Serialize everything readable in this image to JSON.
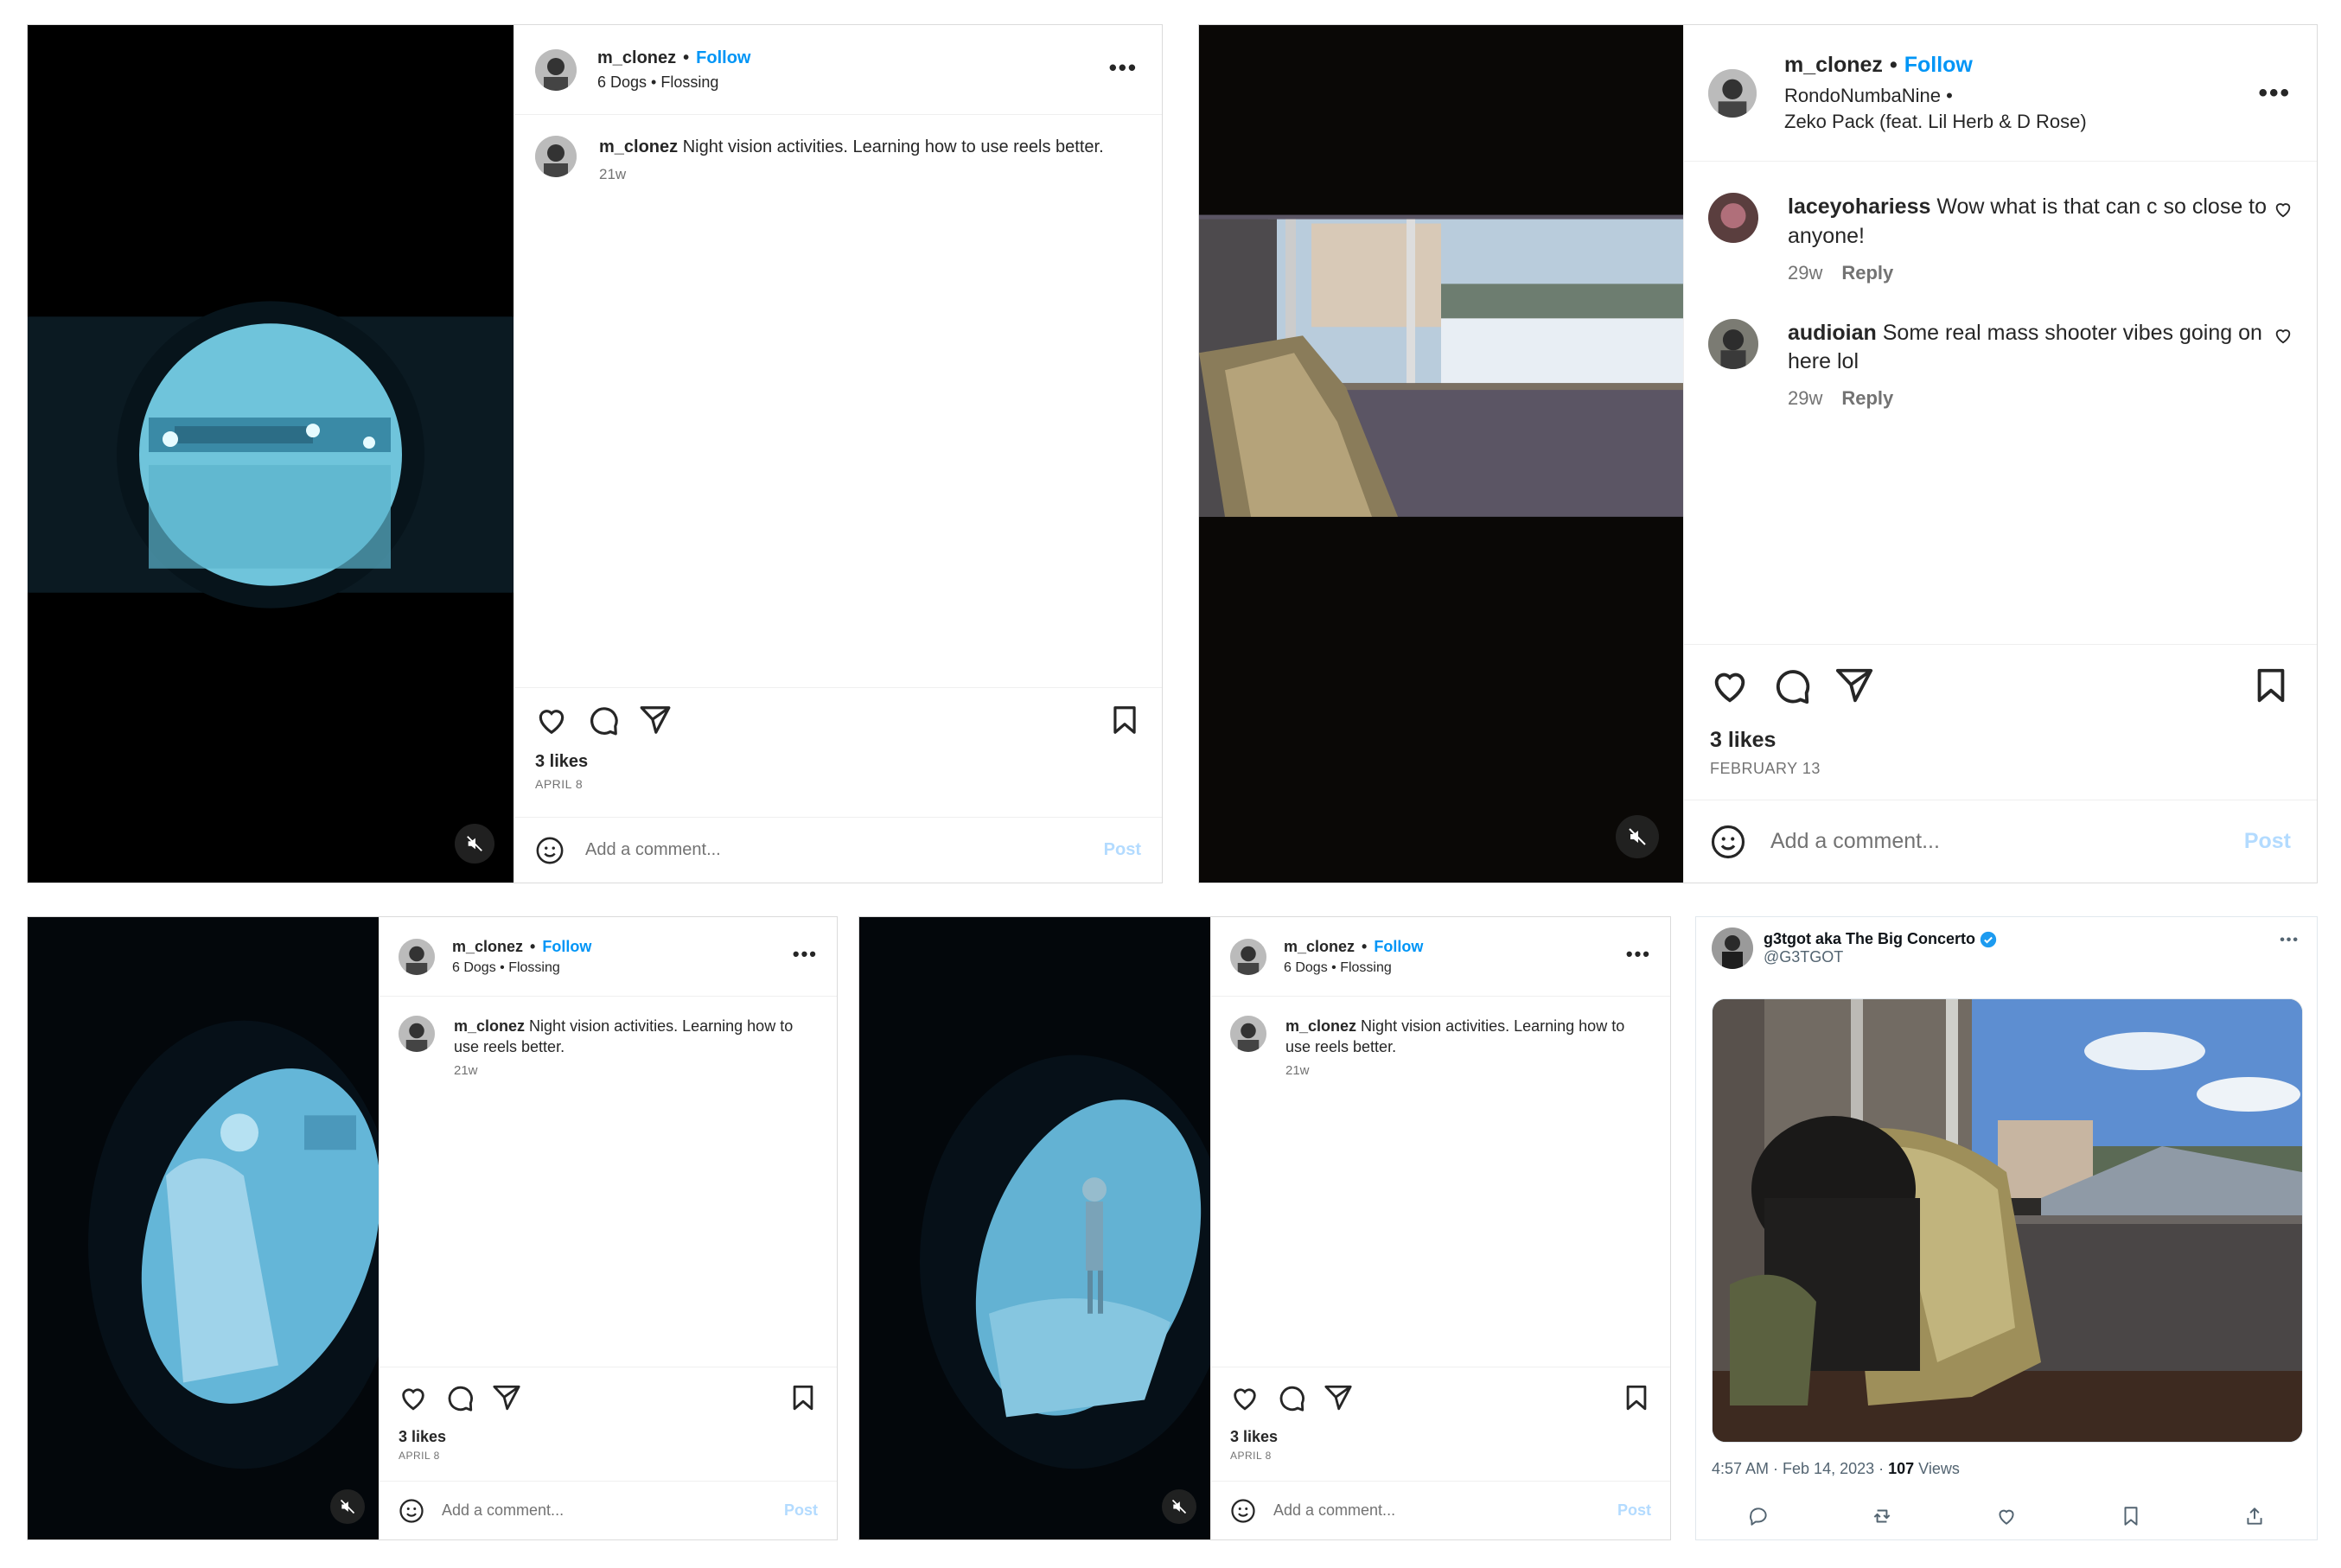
{
  "posts": [
    {
      "username": "m_clonez",
      "follow_label": "Follow",
      "subtitle": "6 Dogs • Flossing",
      "caption_user": "m_clonez",
      "caption_text": "Night vision activities. Learning how to use reels better.",
      "caption_age": "21w",
      "likes": "3 likes",
      "date": "April 8",
      "add_comment_placeholder": "Add a comment...",
      "post_label": "Post"
    },
    {
      "username": "m_clonez",
      "follow_label": "Follow",
      "subtitle_line1": "RondoNumbaNine •",
      "subtitle_line2": "Zeko Pack (feat. Lil Herb & D Rose)",
      "comments": [
        {
          "user": "laceyohariess",
          "text": "Wow what is that can c so close to anyone!",
          "age": "29w",
          "reply_label": "Reply"
        },
        {
          "user": "audioian",
          "text": "Some real mass shooter vibes going on here lol",
          "age": "29w",
          "reply_label": "Reply"
        }
      ],
      "likes": "3 likes",
      "date": "February 13",
      "add_comment_placeholder": "Add a comment...",
      "post_label": "Post"
    },
    {
      "username": "m_clonez",
      "follow_label": "Follow",
      "subtitle": "6 Dogs • Flossing",
      "caption_user": "m_clonez",
      "caption_text": "Night vision activities. Learning how to use reels better.",
      "caption_age": "21w",
      "likes": "3 likes",
      "date": "April 8",
      "add_comment_placeholder": "Add a comment...",
      "post_label": "Post"
    },
    {
      "username": "m_clonez",
      "follow_label": "Follow",
      "subtitle": "6 Dogs • Flossing",
      "caption_user": "m_clonez",
      "caption_text": "Night vision activities. Learning how to use reels better.",
      "caption_age": "21w",
      "likes": "3 likes",
      "date": "April 8",
      "add_comment_placeholder": "Add a comment...",
      "post_label": "Post"
    }
  ],
  "tweet": {
    "display_name": "g3tgot aka The Big Concerto",
    "handle": "@G3TGOT",
    "time": "4:57 AM · Feb 14, 2023 · ",
    "views_count": "107",
    "views_label": " Views",
    "verified_color": "#1d9bf0"
  },
  "icons": [
    "heart-icon",
    "comment-icon",
    "share-icon",
    "bookmark-icon",
    "emoji-icon",
    "mute-icon",
    "more-icon",
    "verified-icon",
    "reply-icon",
    "retweet-icon",
    "like-icon",
    "upload-icon"
  ],
  "colors": {
    "link": "#0095f6",
    "post_disabled": "#b3dbff",
    "night_vision": "#5fc0dd"
  }
}
